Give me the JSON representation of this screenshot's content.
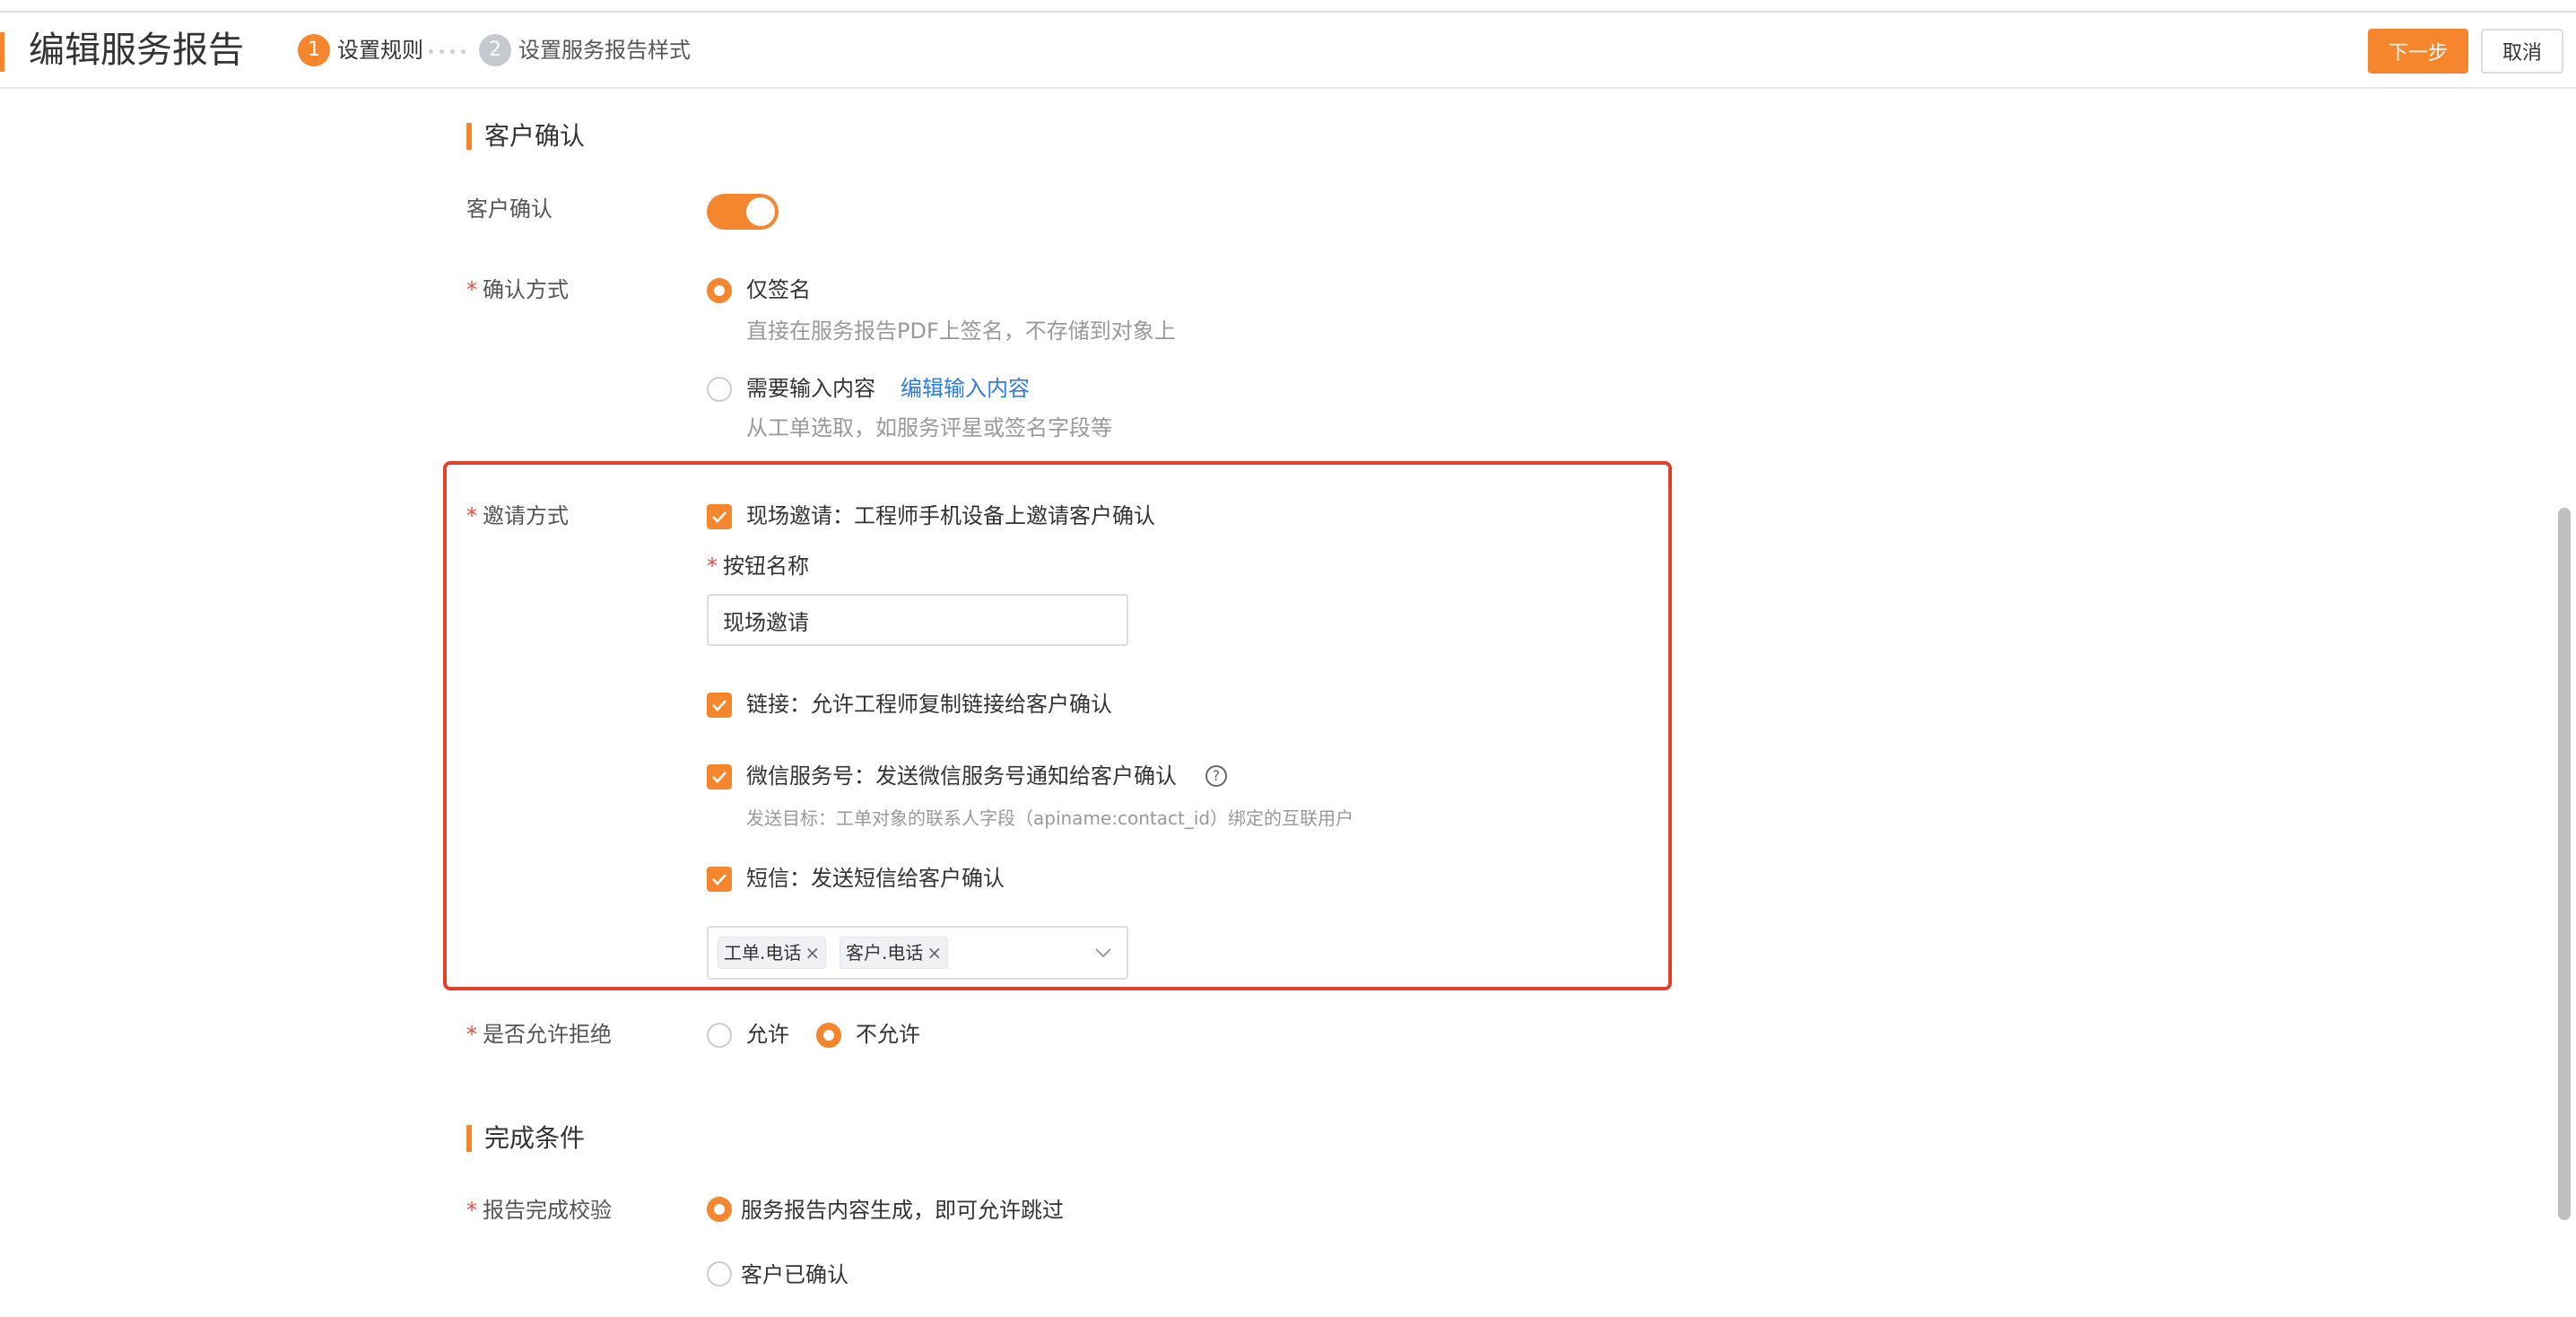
{
  "header": {
    "title": "编辑服务报告",
    "steps": [
      {
        "num": "1",
        "label": "设置规则"
      },
      {
        "num": "2",
        "label": "设置服务报告样式"
      }
    ],
    "next_label": "下一步",
    "cancel_label": "取消"
  },
  "customer_confirm": {
    "section_title": "客户确认",
    "toggle_label": "客户确认",
    "toggle_on": true,
    "method": {
      "label": "确认方式",
      "opt1_label": "仅签名",
      "opt1_hint": "直接在服务报告PDF上签名，不存储到对象上",
      "opt2_label": "需要输入内容",
      "opt2_link": "编辑输入内容",
      "opt2_hint": "从工单选取，如服务评星或签名字段等"
    },
    "invite": {
      "label": "邀请方式",
      "onsite_label": "现场邀请：工程师手机设备上邀请客户确认",
      "button_name_label": "按钮名称",
      "button_name_value": "现场邀请",
      "link_label": "链接：允许工程师复制链接给客户确认",
      "wechat_label": "微信服务号：发送微信服务号通知给客户确认",
      "wechat_hint": "发送目标：工单对象的联系人字段（apiname:contact_id）绑定的互联用户",
      "sms_label": "短信：发送短信给客户确认",
      "sms_tags": [
        "工单.电话",
        "客户.电话"
      ]
    },
    "allow_reject": {
      "label": "是否允许拒绝",
      "allow_label": "允许",
      "deny_label": "不允许"
    }
  },
  "completion": {
    "section_title": "完成条件",
    "check_label": "报告完成校验",
    "opt1_label": "服务报告内容生成，即可允许跳过",
    "opt2_label": "客户已确认"
  },
  "colors": {
    "accent": "#f5862d",
    "link": "#2f7ae5",
    "required": "#f0493e",
    "highlight_frame": "#e3402c"
  }
}
